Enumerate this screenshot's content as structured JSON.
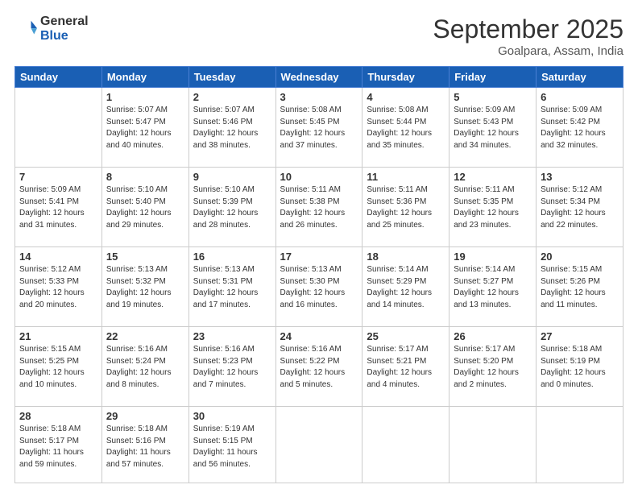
{
  "header": {
    "logo_line1": "General",
    "logo_line2": "Blue",
    "month": "September 2025",
    "location": "Goalpara, Assam, India"
  },
  "weekdays": [
    "Sunday",
    "Monday",
    "Tuesday",
    "Wednesday",
    "Thursday",
    "Friday",
    "Saturday"
  ],
  "weeks": [
    [
      {
        "day": "",
        "detail": ""
      },
      {
        "day": "1",
        "detail": "Sunrise: 5:07 AM\nSunset: 5:47 PM\nDaylight: 12 hours\nand 40 minutes."
      },
      {
        "day": "2",
        "detail": "Sunrise: 5:07 AM\nSunset: 5:46 PM\nDaylight: 12 hours\nand 38 minutes."
      },
      {
        "day": "3",
        "detail": "Sunrise: 5:08 AM\nSunset: 5:45 PM\nDaylight: 12 hours\nand 37 minutes."
      },
      {
        "day": "4",
        "detail": "Sunrise: 5:08 AM\nSunset: 5:44 PM\nDaylight: 12 hours\nand 35 minutes."
      },
      {
        "day": "5",
        "detail": "Sunrise: 5:09 AM\nSunset: 5:43 PM\nDaylight: 12 hours\nand 34 minutes."
      },
      {
        "day": "6",
        "detail": "Sunrise: 5:09 AM\nSunset: 5:42 PM\nDaylight: 12 hours\nand 32 minutes."
      }
    ],
    [
      {
        "day": "7",
        "detail": "Sunrise: 5:09 AM\nSunset: 5:41 PM\nDaylight: 12 hours\nand 31 minutes."
      },
      {
        "day": "8",
        "detail": "Sunrise: 5:10 AM\nSunset: 5:40 PM\nDaylight: 12 hours\nand 29 minutes."
      },
      {
        "day": "9",
        "detail": "Sunrise: 5:10 AM\nSunset: 5:39 PM\nDaylight: 12 hours\nand 28 minutes."
      },
      {
        "day": "10",
        "detail": "Sunrise: 5:11 AM\nSunset: 5:38 PM\nDaylight: 12 hours\nand 26 minutes."
      },
      {
        "day": "11",
        "detail": "Sunrise: 5:11 AM\nSunset: 5:36 PM\nDaylight: 12 hours\nand 25 minutes."
      },
      {
        "day": "12",
        "detail": "Sunrise: 5:11 AM\nSunset: 5:35 PM\nDaylight: 12 hours\nand 23 minutes."
      },
      {
        "day": "13",
        "detail": "Sunrise: 5:12 AM\nSunset: 5:34 PM\nDaylight: 12 hours\nand 22 minutes."
      }
    ],
    [
      {
        "day": "14",
        "detail": "Sunrise: 5:12 AM\nSunset: 5:33 PM\nDaylight: 12 hours\nand 20 minutes."
      },
      {
        "day": "15",
        "detail": "Sunrise: 5:13 AM\nSunset: 5:32 PM\nDaylight: 12 hours\nand 19 minutes."
      },
      {
        "day": "16",
        "detail": "Sunrise: 5:13 AM\nSunset: 5:31 PM\nDaylight: 12 hours\nand 17 minutes."
      },
      {
        "day": "17",
        "detail": "Sunrise: 5:13 AM\nSunset: 5:30 PM\nDaylight: 12 hours\nand 16 minutes."
      },
      {
        "day": "18",
        "detail": "Sunrise: 5:14 AM\nSunset: 5:29 PM\nDaylight: 12 hours\nand 14 minutes."
      },
      {
        "day": "19",
        "detail": "Sunrise: 5:14 AM\nSunset: 5:27 PM\nDaylight: 12 hours\nand 13 minutes."
      },
      {
        "day": "20",
        "detail": "Sunrise: 5:15 AM\nSunset: 5:26 PM\nDaylight: 12 hours\nand 11 minutes."
      }
    ],
    [
      {
        "day": "21",
        "detail": "Sunrise: 5:15 AM\nSunset: 5:25 PM\nDaylight: 12 hours\nand 10 minutes."
      },
      {
        "day": "22",
        "detail": "Sunrise: 5:16 AM\nSunset: 5:24 PM\nDaylight: 12 hours\nand 8 minutes."
      },
      {
        "day": "23",
        "detail": "Sunrise: 5:16 AM\nSunset: 5:23 PM\nDaylight: 12 hours\nand 7 minutes."
      },
      {
        "day": "24",
        "detail": "Sunrise: 5:16 AM\nSunset: 5:22 PM\nDaylight: 12 hours\nand 5 minutes."
      },
      {
        "day": "25",
        "detail": "Sunrise: 5:17 AM\nSunset: 5:21 PM\nDaylight: 12 hours\nand 4 minutes."
      },
      {
        "day": "26",
        "detail": "Sunrise: 5:17 AM\nSunset: 5:20 PM\nDaylight: 12 hours\nand 2 minutes."
      },
      {
        "day": "27",
        "detail": "Sunrise: 5:18 AM\nSunset: 5:19 PM\nDaylight: 12 hours\nand 0 minutes."
      }
    ],
    [
      {
        "day": "28",
        "detail": "Sunrise: 5:18 AM\nSunset: 5:17 PM\nDaylight: 11 hours\nand 59 minutes."
      },
      {
        "day": "29",
        "detail": "Sunrise: 5:18 AM\nSunset: 5:16 PM\nDaylight: 11 hours\nand 57 minutes."
      },
      {
        "day": "30",
        "detail": "Sunrise: 5:19 AM\nSunset: 5:15 PM\nDaylight: 11 hours\nand 56 minutes."
      },
      {
        "day": "",
        "detail": ""
      },
      {
        "day": "",
        "detail": ""
      },
      {
        "day": "",
        "detail": ""
      },
      {
        "day": "",
        "detail": ""
      }
    ]
  ]
}
